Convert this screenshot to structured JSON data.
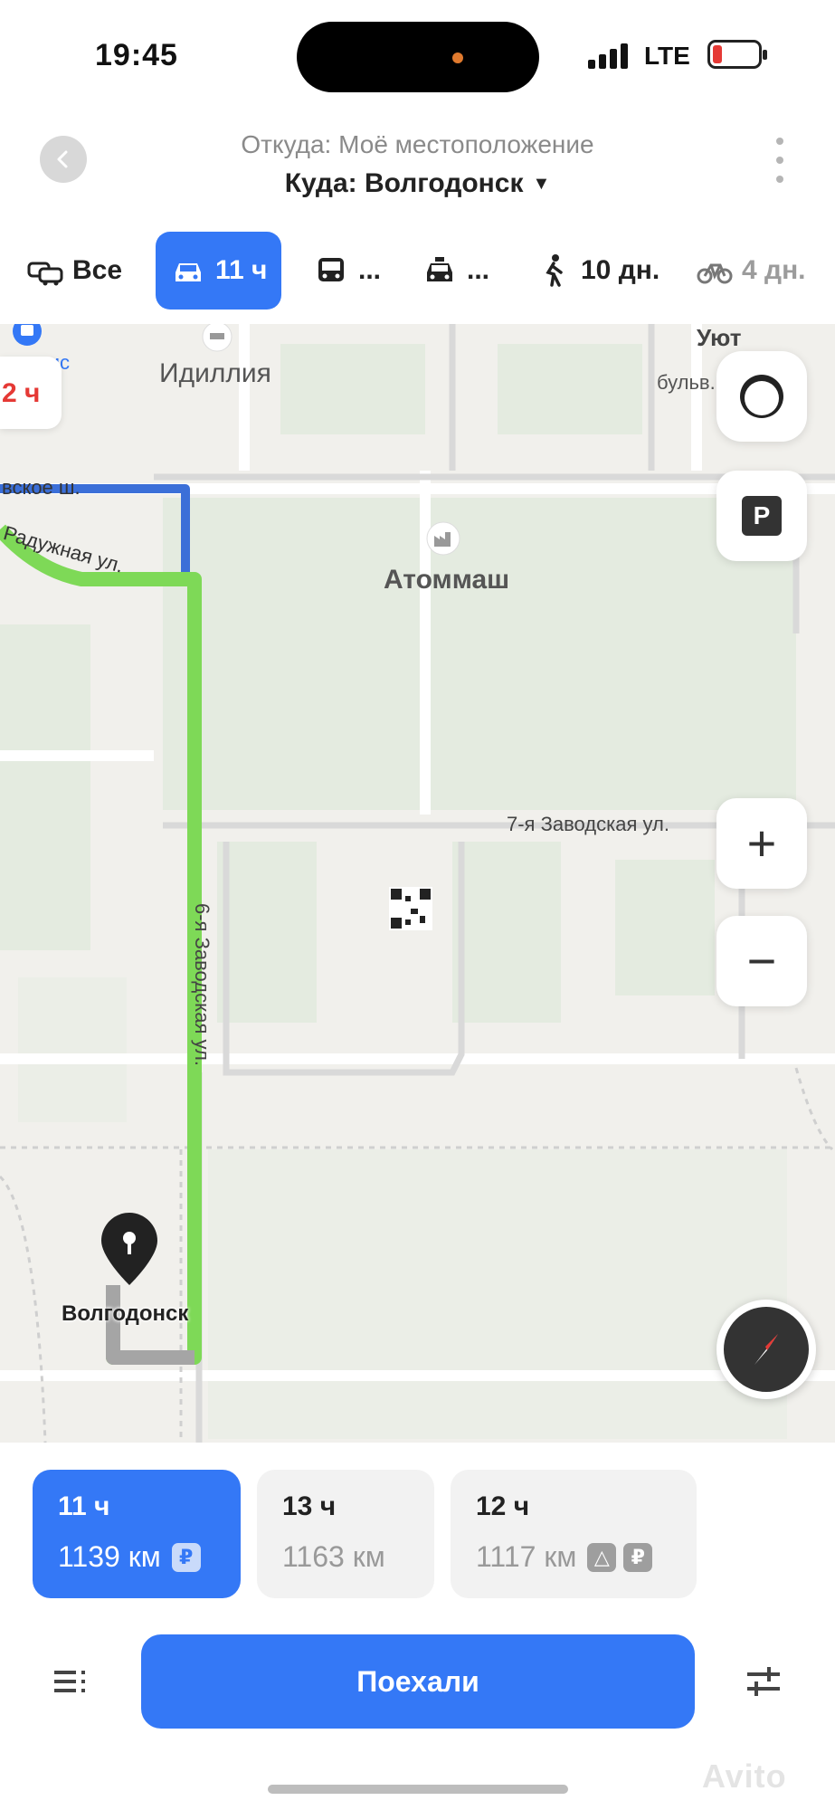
{
  "status_bar": {
    "time": "19:45",
    "network": "LTE",
    "battery_level": 0.2
  },
  "header": {
    "from_text": "Откуда: Моё местоположение",
    "to_text": "Куда: Волгодонск",
    "to_caret": "▼"
  },
  "transport_tabs": [
    {
      "icon": "cars-icon",
      "label": "Все",
      "active": false
    },
    {
      "icon": "car-icon",
      "label": "11 ч",
      "active": true
    },
    {
      "icon": "bus-icon",
      "label": "...",
      "active": false
    },
    {
      "icon": "taxi-icon",
      "label": "...",
      "active": false
    },
    {
      "icon": "walk-icon",
      "label": "10 дн.",
      "active": false
    },
    {
      "icon": "bike-icon",
      "label": "4 дн.",
      "active": false
    }
  ],
  "map": {
    "labels": {
      "idilliya": "Идиллия",
      "uyut": "Уют",
      "bulvar": "бульв.",
      "shosse": "вское ш.",
      "raduzhnaya": "Радужная ул.",
      "atommash": "Атоммаш",
      "zavodskaya7": "7-я Заводская ул.",
      "zavodskaya6": "6-я Заводская ул.",
      "poi_small": "вис"
    },
    "left_chip_text": "2 ч",
    "destination_label": "Волгодонск",
    "parking_label": "P",
    "zoom_in_label": "+",
    "zoom_out_label": "−",
    "colors": {
      "route_main": "#7ed957",
      "route_alt": "#3b6fd8",
      "route_end": "#a5a5a5"
    }
  },
  "routes": [
    {
      "time": "11 ч",
      "distance": "1139 км",
      "badges": [
        "₽"
      ],
      "active": true
    },
    {
      "time": "13 ч",
      "distance": "1163 км",
      "badges": [],
      "active": false
    },
    {
      "time": "12 ч",
      "distance": "1117 км",
      "badges": [
        "△",
        "₽"
      ],
      "active": false
    }
  ],
  "actions": {
    "go_label": "Поехали"
  },
  "watermark": "Avito",
  "colors": {
    "accent": "#3478f6"
  }
}
